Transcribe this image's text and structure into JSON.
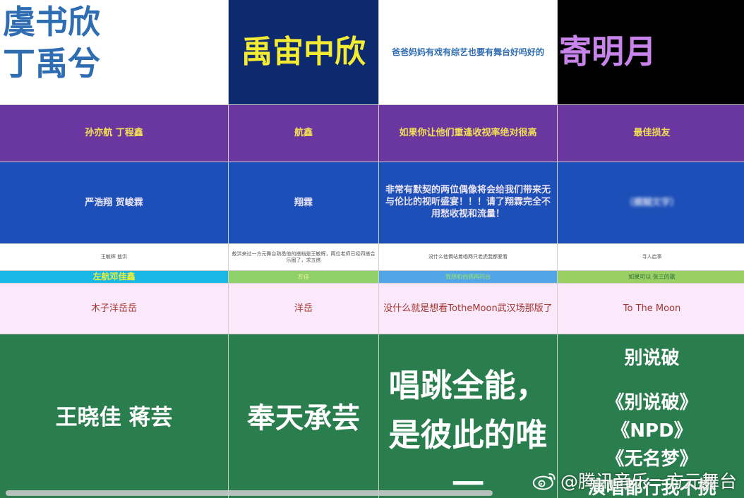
{
  "row1": {
    "c1_line1": "虞书欣",
    "c1_line2": "丁禹兮",
    "c2": "禹宙中欣",
    "c3": "爸爸妈妈有戏有综艺也要有舞台好吗好的",
    "c4": "寄明月"
  },
  "row2": {
    "c1": "孙亦航 丁程鑫",
    "c2": "航鑫",
    "c3": "如果你让他们重逢收视率绝对很高",
    "c4": "最佳损友"
  },
  "row3": {
    "c1": "严浩翔 贺峻霖",
    "c2": "翔霖",
    "c3": "非常有默契的两位偶像将会给我们带来无与伦比的视听盛宴！！！请了翔霖完全不用愁收视和流量！",
    "c4": "（模糊文字）"
  },
  "row4": {
    "c1": "王敏辉 敖洪",
    "c2": "敖洪来过一方元舞台熟悉他的搭档是王敏辉，两位老师已经四搭合乐圈了，求五搭",
    "c3": "没什么他俩站着唱两只老虎我都爱看",
    "c4": "寻人启事"
  },
  "row5": {
    "c1": "左航邓佳鑫",
    "c2": "左佳",
    "c3": "我想和他俩再同台",
    "c4": "如果可以 张三的歌"
  },
  "row6": {
    "c1": "木子洋岳岳",
    "c2": "洋岳",
    "c3": "没什么就是想看TotheMoon武汉场那版了",
    "c4": "To The Moon"
  },
  "row7": {
    "c1": "王晓佳 蒋芸",
    "c2": "奉天承芸",
    "c3": "唱跳全能，是彼此的唯一",
    "c4_title": "别说破",
    "c4_song1": "《别说破》",
    "c4_song2": "《NPD》",
    "c4_song3": "《无名梦》",
    "c4_tail": "演唱都行我不挑"
  },
  "watermark": {
    "text": "@腾讯音乐一方元舞台",
    "icon": "weibo-icon"
  },
  "colors": {
    "row1_c2_bg": "#0e2a6e",
    "row2_bg": "#6a37a0",
    "row3_bg": "#1d4fb8",
    "row6_bg": "#fbe8fb",
    "row7_bg": "#2a7d4d"
  }
}
